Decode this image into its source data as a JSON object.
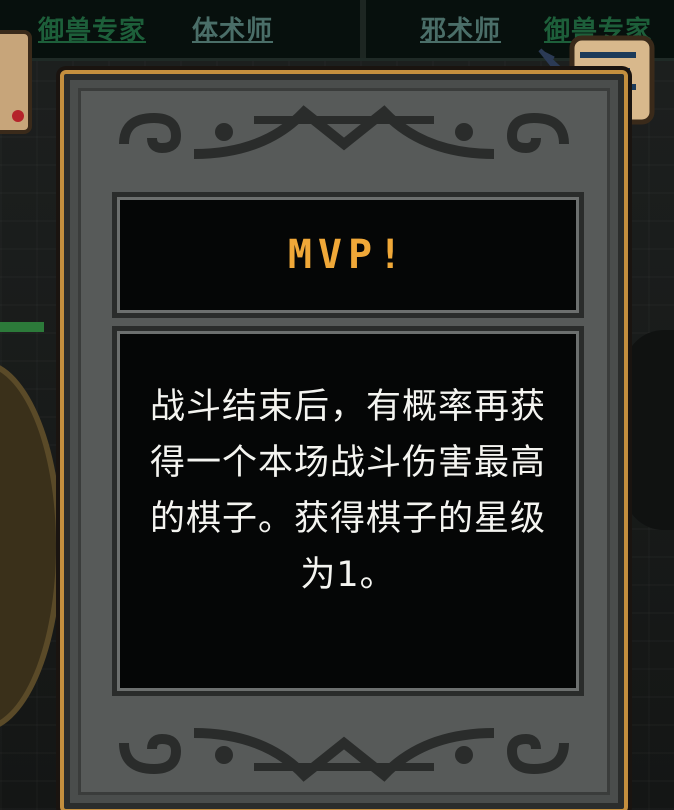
{
  "background": {
    "left_tags": [
      "御兽专家",
      "体术师"
    ],
    "right_tags": [
      "邪术师",
      "御兽专家"
    ]
  },
  "modal": {
    "title": "MVP!",
    "description": "战斗结束后，有概率再获得一个本场战斗伤害最高的棋子。获得棋子的星级为1。"
  },
  "icons": {
    "scroll": "scroll-with-quill-icon",
    "ornament": "swirl-ornament"
  },
  "colors": {
    "title": "#f0a838",
    "frame": "#c48f3e",
    "text": "#f4f4f0",
    "tag_green": "#1d5f3a"
  }
}
